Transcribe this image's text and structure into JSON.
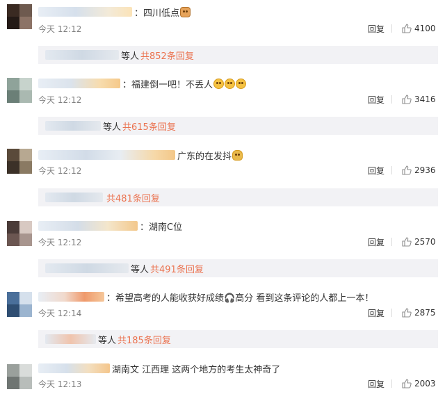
{
  "comments": [
    {
      "text": "：四川低点",
      "emojis": [
        "cat"
      ],
      "time": "今天 12:12",
      "reply_label": "回复",
      "likes": "4100",
      "sub_who": "等人",
      "sub_count": "共852条回复",
      "avatar_colors": [
        "#3a2a22",
        "#6e5a4f",
        "#241a16",
        "#8c7366"
      ]
    },
    {
      "text": "：福建倒一吧！不丢人",
      "emojis": [
        "sad",
        "sad",
        "sad"
      ],
      "time": "今天 12:12",
      "reply_label": "回复",
      "likes": "3416",
      "sub_who": "等人",
      "sub_count": "共615条回复",
      "avatar_colors": [
        "#8fa39a",
        "#c7d3cc",
        "#6b7f77",
        "#aab9b1"
      ]
    },
    {
      "text": "广东的在发抖",
      "emojis": [
        "fig"
      ],
      "time": "今天 12:12",
      "reply_label": "回复",
      "likes": "2936",
      "sub_who": "",
      "sub_count": "共481条回复",
      "avatar_colors": [
        "#5a4a3a",
        "#b7a891",
        "#3c3128",
        "#8a7a63"
      ]
    },
    {
      "text": "：湖南C位",
      "emojis": [],
      "time": "今天 12:12",
      "reply_label": "回复",
      "likes": "2570",
      "sub_who": "等人",
      "sub_count": "共491条回复",
      "avatar_colors": [
        "#4a3b38",
        "#d8c9c2",
        "#6b5651",
        "#a8958e"
      ]
    },
    {
      "text": "：希望高考的人能收获好成绩🎧高分 看到这条评论的人都上一本！",
      "emojis": [],
      "time": "今天 12:14",
      "reply_label": "回复",
      "likes": "2875",
      "sub_who": "等人",
      "sub_count": "共185条回复",
      "avatar_colors": [
        "#4a6f9a",
        "#d5e0ec",
        "#2f4e72",
        "#9bb4cf"
      ]
    },
    {
      "text": "湖南文 江西理   这两个地方的考生太神奇了",
      "emojis": [],
      "time": "今天 12:13",
      "reply_label": "回复",
      "likes": "2003",
      "sub_who": "",
      "sub_count": "",
      "avatar_colors": [
        "#9aa09c",
        "#d9dcda",
        "#6f7572",
        "#b8bdba"
      ]
    }
  ]
}
